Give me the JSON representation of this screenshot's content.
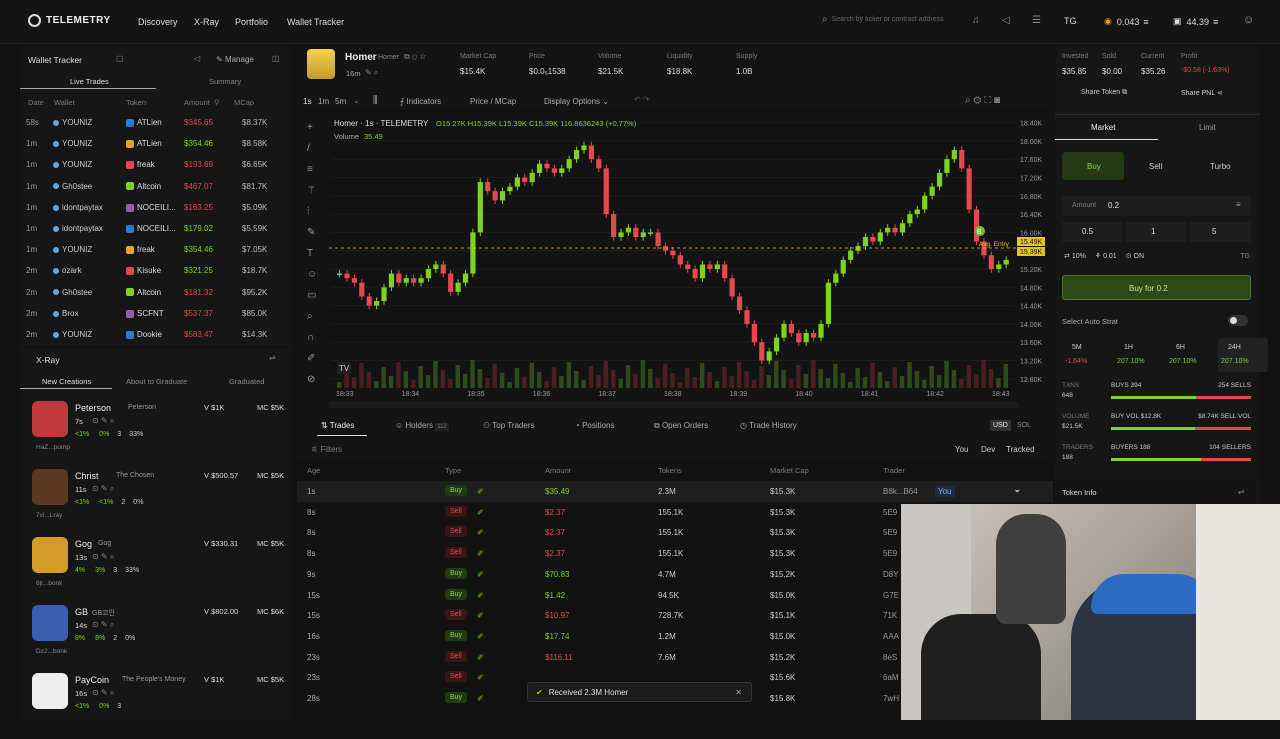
{
  "colors": {
    "buy": "#7ed321",
    "sell": "#e5484d",
    "accent": "#e6c229",
    "bg": "#121212"
  },
  "nav": {
    "logo": "TELEMETRY",
    "items": [
      "Discovery",
      "X-Ray",
      "Portfolio",
      "Wallet Tracker"
    ],
    "search_placeholder": "Search by ticker or contract address",
    "tg": "TG",
    "sol1": "0.043",
    "sol2": "44.39"
  },
  "wallet_tracker": {
    "title": "Wallet Tracker",
    "manage": "Manage",
    "tabs": [
      "Live Trades",
      "Summary"
    ],
    "headers": [
      "Date",
      "Wallet",
      "Token",
      "Amount",
      "MCap"
    ],
    "rows": [
      {
        "date": "58s",
        "wallet": "YOUNIZ",
        "token": "ATLien",
        "amount": "$345.65",
        "mcap": "$8.37K",
        "side": "sell"
      },
      {
        "date": "1m",
        "wallet": "YOUNIZ",
        "token": "ATLien",
        "amount": "$354.46",
        "mcap": "$8.58K",
        "side": "buy"
      },
      {
        "date": "1m",
        "wallet": "YOUNIZ",
        "token": "freak",
        "amount": "$193.69",
        "mcap": "$6.65K",
        "side": "sell"
      },
      {
        "date": "1m",
        "wallet": "Gh0stee",
        "token": "Altcoin",
        "amount": "$467.07",
        "mcap": "$81.7K",
        "side": "sell"
      },
      {
        "date": "1m",
        "wallet": "idontpaytax",
        "token": "NOCEILI...",
        "amount": "$163.25",
        "mcap": "$5.09K",
        "side": "sell"
      },
      {
        "date": "1m",
        "wallet": "idontpaytax",
        "token": "NOCEILI...",
        "amount": "$179.02",
        "mcap": "$5.59K",
        "side": "buy"
      },
      {
        "date": "1m",
        "wallet": "YOUNIZ",
        "token": "freak",
        "amount": "$354.46",
        "mcap": "$7.05K",
        "side": "buy"
      },
      {
        "date": "2m",
        "wallet": "ozark",
        "token": "Kisuke",
        "amount": "$321.25",
        "mcap": "$18.7K",
        "side": "buy"
      },
      {
        "date": "2m",
        "wallet": "Gh0stee",
        "token": "Altcoin",
        "amount": "$181.32",
        "mcap": "$95.2K",
        "side": "sell"
      },
      {
        "date": "2m",
        "wallet": "Brox",
        "token": "SCFNT",
        "amount": "$537.37",
        "mcap": "$85.0K",
        "side": "sell"
      },
      {
        "date": "2m",
        "wallet": "YOUNIZ",
        "token": "Dookie",
        "amount": "$583.47",
        "mcap": "$14.3K",
        "side": "sell"
      }
    ]
  },
  "xray": {
    "title": "X-Ray",
    "tabs": [
      "New Creations",
      "About to Graduate",
      "Graduated"
    ],
    "items": [
      {
        "name": "Peterson",
        "sub": "Peterson",
        "age": "7s",
        "v": "V $1K",
        "mc": "MC $5K",
        "foot": "HaZ...pump",
        "p1": "<1%",
        "p2": "0%",
        "p3": "3",
        "p4": "33%"
      },
      {
        "name": "Christ",
        "sub": "The Chosen",
        "age": "11s",
        "v": "V $500.57",
        "mc": "MC $5K",
        "foot": "7xi...Lray",
        "p1": "<1%",
        "p2": "<1%",
        "p3": "2",
        "p4": "0%"
      },
      {
        "name": "Gog",
        "sub": "Gog",
        "age": "13s",
        "v": "V $330.31",
        "mc": "MC $5K",
        "foot": "6jt...bonk",
        "p1": "4%",
        "p2": "3%",
        "p3": "3",
        "p4": "33%"
      },
      {
        "name": "GB",
        "sub": "GB코인",
        "age": "14s",
        "v": "V $802.00",
        "mc": "MC $6K",
        "foot": "Dz2...bonk",
        "p1": "8%",
        "p2": "8%",
        "p3": "2",
        "p4": "0%"
      },
      {
        "name": "PayCoin",
        "sub": "The People's Money",
        "age": "16s",
        "v": "V $1K",
        "mc": "MC $5K",
        "foot": "",
        "p1": "<1%",
        "p2": "0%",
        "p3": "3",
        "p4": ""
      }
    ]
  },
  "token": {
    "name": "Homer",
    "ticker": "Homer",
    "age": "16m",
    "stats": [
      {
        "label": "Market Cap",
        "value": "$15.4K"
      },
      {
        "label": "Price",
        "value": "$0.0₅1538"
      },
      {
        "label": "Volume",
        "value": "$21.5K"
      },
      {
        "label": "Liquidity",
        "value": "$18.8K"
      },
      {
        "label": "Supply",
        "value": "1.0B"
      }
    ]
  },
  "chart_toolbar": {
    "intervals": [
      "1s",
      "1m",
      "5m"
    ],
    "indicators": "Indicators",
    "price_mcap": "Price / MCap",
    "display": "Display Options"
  },
  "chart_data": {
    "type": "candlestick",
    "title": "Homer · 1s · TELEMETRY",
    "ohlc": "O15.27K H15.39K L15.39K C15.39K 116.8636243 (+0.77%)",
    "volume_label": "Volume",
    "volume_value": "35.49",
    "y_ticks": [
      "18.40K",
      "18.00K",
      "17.60K",
      "17.20K",
      "16.80K",
      "16.40K",
      "16.00K",
      "15.60K",
      "15.20K",
      "14.80K",
      "14.40K",
      "14.00K",
      "13.60K",
      "13.20K",
      "12.80K"
    ],
    "x_ticks": [
      "18:33",
      "18:34",
      "18:35",
      "18:36",
      "18:37",
      "18:38",
      "18:39",
      "18:40",
      "18:41",
      "18:42",
      "18:43"
    ],
    "last_price_labels": [
      "15.49K",
      "15.39K"
    ],
    "avg_entry": "Avg. Entry",
    "close_series": [
      15.1,
      15.0,
      14.9,
      14.6,
      14.4,
      14.5,
      14.8,
      15.1,
      14.9,
      15.0,
      14.9,
      15.0,
      15.2,
      15.3,
      15.1,
      14.7,
      14.9,
      15.1,
      16.0,
      17.1,
      16.9,
      16.7,
      16.9,
      17.0,
      17.2,
      17.1,
      17.3,
      17.5,
      17.4,
      17.3,
      17.4,
      17.6,
      17.8,
      17.9,
      17.6,
      17.4,
      16.4,
      15.9,
      16.0,
      16.1,
      15.9,
      16.0,
      16.0,
      15.7,
      15.6,
      15.5,
      15.3,
      15.2,
      15.0,
      15.3,
      15.2,
      15.3,
      15.0,
      14.6,
      14.3,
      14.0,
      13.6,
      13.2,
      13.4,
      13.7,
      14.0,
      13.8,
      13.6,
      13.8,
      13.7,
      14.0,
      14.9,
      15.1,
      15.4,
      15.6,
      15.7,
      15.9,
      15.8,
      16.0,
      16.1,
      16.0,
      16.2,
      16.4,
      16.5,
      16.8,
      17.0,
      17.3,
      17.6,
      17.8,
      17.4,
      16.5,
      15.8,
      15.5,
      15.2,
      15.3,
      15.4
    ]
  },
  "bottom_tabs": {
    "tabs": [
      "Trades",
      "Holders",
      "Top Traders",
      "Positions",
      "Open Orders",
      "Trade History"
    ],
    "holders_count": "112",
    "currency": [
      "USD",
      "SOL"
    ],
    "filters": "Filters",
    "filter_btns": [
      "You",
      "Dev",
      "Tracked"
    ],
    "headers": [
      "Age",
      "Type",
      "Amount",
      "Tokens",
      "Market Cap",
      "Trader"
    ]
  },
  "trades": [
    {
      "age": "1s",
      "type": "Buy",
      "amount": "$35.49",
      "tokens": "2.3M",
      "mcap": "$15.3K",
      "trader": "B8k...B64",
      "you": "You"
    },
    {
      "age": "8s",
      "type": "Sell",
      "amount": "$2.37",
      "tokens": "155.1K",
      "mcap": "$15.3K",
      "trader": "5E9",
      "you": ""
    },
    {
      "age": "8s",
      "type": "Sell",
      "amount": "$2.37",
      "tokens": "155.1K",
      "mcap": "$15.3K",
      "trader": "5E9",
      "you": ""
    },
    {
      "age": "8s",
      "type": "Sell",
      "amount": "$2.37",
      "tokens": "155.1K",
      "mcap": "$15.3K",
      "trader": "5E9",
      "you": ""
    },
    {
      "age": "9s",
      "type": "Buy",
      "amount": "$70.83",
      "tokens": "4.7M",
      "mcap": "$15.2K",
      "trader": "D8Y",
      "you": ""
    },
    {
      "age": "15s",
      "type": "Buy",
      "amount": "$1.42",
      "tokens": "94.5K",
      "mcap": "$15.0K",
      "trader": "G7E",
      "you": ""
    },
    {
      "age": "15s",
      "type": "Sell",
      "amount": "$10.97",
      "tokens": "728.7K",
      "mcap": "$15.1K",
      "trader": "71K",
      "you": ""
    },
    {
      "age": "16s",
      "type": "Buy",
      "amount": "$17.74",
      "tokens": "1.2M",
      "mcap": "$15.0K",
      "trader": "AAA",
      "you": ""
    },
    {
      "age": "23s",
      "type": "Sell",
      "amount": "$116.11",
      "tokens": "7.6M",
      "mcap": "$15.2K",
      "trader": "8eS",
      "you": ""
    },
    {
      "age": "23s",
      "type": "Sell",
      "amount": "",
      "tokens": "",
      "mcap": "$15.6K",
      "trader": "6aM",
      "you": ""
    },
    {
      "age": "28s",
      "type": "Buy",
      "amount": "",
      "tokens": "",
      "mcap": "$15.8K",
      "trader": "7wH",
      "you": ""
    }
  ],
  "toast": {
    "text": "Received 2.3M Homer"
  },
  "right": {
    "invested_l": "Invested",
    "invested": "$35.85",
    "sold_l": "Sold",
    "sold": "$0.00",
    "current_l": "Current",
    "current": "$35.26",
    "profit_l": "Profit",
    "profit": "-$0.58 (-1.63%)",
    "share_token": "Share Token",
    "share_pnl": "Share PNL",
    "order_tabs": [
      "Market",
      "Limit"
    ],
    "side_tabs": [
      "Buy",
      "Sell",
      "Turbo"
    ],
    "amount_l": "Amount",
    "amount": "0.2",
    "presets": [
      "0.5",
      "1",
      "5"
    ],
    "preset_unit": "TG",
    "slippage": "10%",
    "prio": "0.01",
    "mev": "ON",
    "buy_btn": "Buy for 0.2",
    "auto_strat": "Select Auto Strat",
    "periods": [
      {
        "l": "5M",
        "v": "-1.64%"
      },
      {
        "l": "1H",
        "v": "207.10%"
      },
      {
        "l": "6H",
        "v": "207.10%"
      },
      {
        "l": "24H",
        "v": "207.10%"
      }
    ],
    "txns_l": "TXNS",
    "txns": "648",
    "buys": "BUYS 394",
    "sells": "254 SELLS",
    "buys_frac": 0.61,
    "vol_l": "VOLUME",
    "vol": "$21.5K",
    "buy_vol": "BUY VOL $12.8K",
    "sell_vol": "$8.74K SELL VOL",
    "vol_frac": 0.6,
    "traders_l": "TRADERS",
    "traders": "188",
    "buyers": "BUYERS 188",
    "sellers": "104 SELLERS",
    "traders_frac": 0.64,
    "token_info": "Token Info"
  }
}
